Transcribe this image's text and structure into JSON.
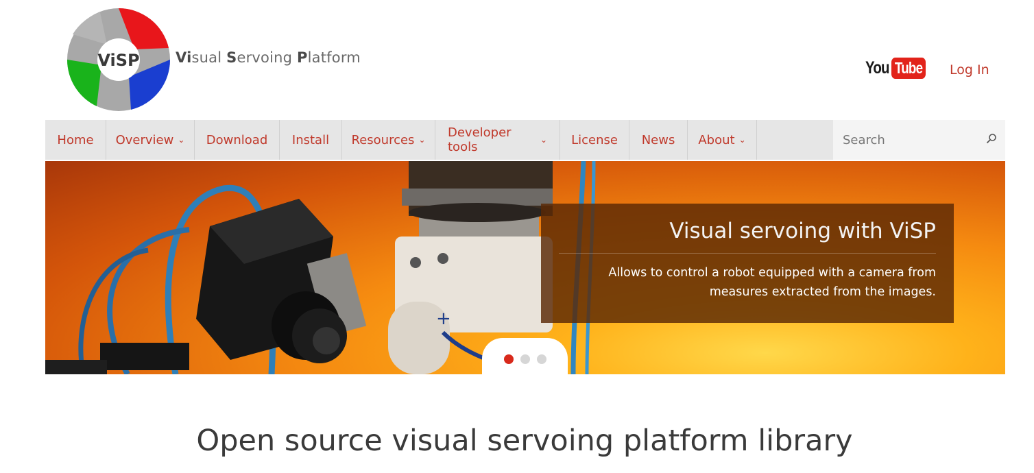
{
  "logo": {
    "badge_text": "ViSP",
    "wordmark": [
      "Vi",
      "sual ",
      "S",
      "ervoing ",
      "P",
      "latform"
    ],
    "colors": {
      "red": "#e8161b",
      "blue": "#1a3ed0",
      "green": "#19b31b",
      "gray": "#a8a8a8"
    }
  },
  "header": {
    "youtube_you": "You",
    "youtube_tube": "Tube",
    "login_label": "Log In"
  },
  "nav": {
    "items": [
      {
        "label": "Home",
        "has_dropdown": false
      },
      {
        "label": "Overview",
        "has_dropdown": true
      },
      {
        "label": "Download",
        "has_dropdown": false
      },
      {
        "label": "Install",
        "has_dropdown": false
      },
      {
        "label": "Resources",
        "has_dropdown": true
      },
      {
        "label": "Developer tools",
        "has_dropdown": true
      },
      {
        "label": "License",
        "has_dropdown": false
      },
      {
        "label": "News",
        "has_dropdown": false
      },
      {
        "label": "About",
        "has_dropdown": true
      }
    ],
    "search_placeholder": "Search",
    "search_icon": "search-icon"
  },
  "hero": {
    "caption_title": "Visual servoing with ViSP",
    "caption_text": "Allows to control a robot equipped with a camera from measures extracted from the images.",
    "slides": 3,
    "active_slide": 1,
    "accent": "#d8291b"
  },
  "main": {
    "headline": "Open source visual servoing platform library"
  },
  "colors": {
    "link": "#c0392b",
    "nav_bg": "#e6e6e6"
  }
}
